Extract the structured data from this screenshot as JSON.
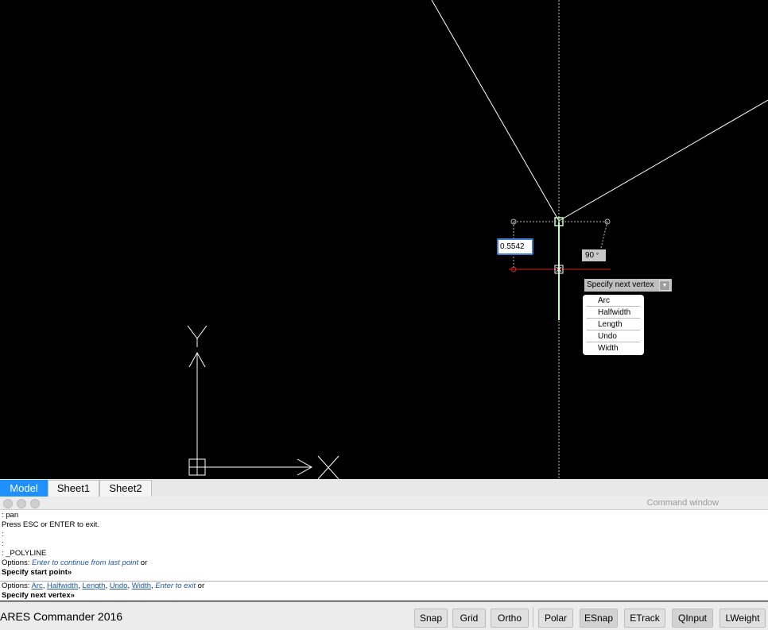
{
  "canvas": {
    "dynamic_input_value": "0.5542",
    "angle_value": "90",
    "angle_unit": "°",
    "prompt_label": "Specify next vertex",
    "options_menu": [
      "Arc",
      "Halfwidth",
      "Length",
      "Undo",
      "Width"
    ]
  },
  "tabs": [
    {
      "label": "Model",
      "active": true
    },
    {
      "label": "Sheet1",
      "active": false
    },
    {
      "label": "Sheet2",
      "active": false
    }
  ],
  "command_window": {
    "title": "Command window",
    "history": {
      "line1": ": pan",
      "line2": "Press ESC or ENTER to exit.",
      "line3": ":",
      "line4": ":",
      "line5": ": _POLYLINE",
      "line6_prefix": "Options: ",
      "line6_link": "Enter to continue from last point",
      "line6_suffix": " or",
      "line7": "Specify start point»"
    },
    "current": {
      "prefix": "Options: ",
      "opt_arc": "Arc",
      "opt_halfwidth": "Halfwidth",
      "opt_length": "Length",
      "opt_undo": "Undo",
      "opt_width": "Width",
      "sep": ", ",
      "enter_exit": "Enter to exit",
      "suffix": " or",
      "prompt": "Specify next vertex»"
    }
  },
  "status_bar": {
    "app_title": "ARES Commander 2016",
    "buttons": {
      "snap": "Snap",
      "grid": "Grid",
      "ortho": "Ortho",
      "polar": "Polar",
      "esnap": "ESnap",
      "etrack": "ETrack",
      "qinput": "QInput",
      "lweight": "LWeight"
    }
  },
  "colors": {
    "canvas_bg": "#000000",
    "drawing_line": "#ffffff",
    "rubberband": "#c0ffc0",
    "polar_line": "#d02020",
    "active_tab": "#1e90ff",
    "option_link": "#1f58a8"
  }
}
